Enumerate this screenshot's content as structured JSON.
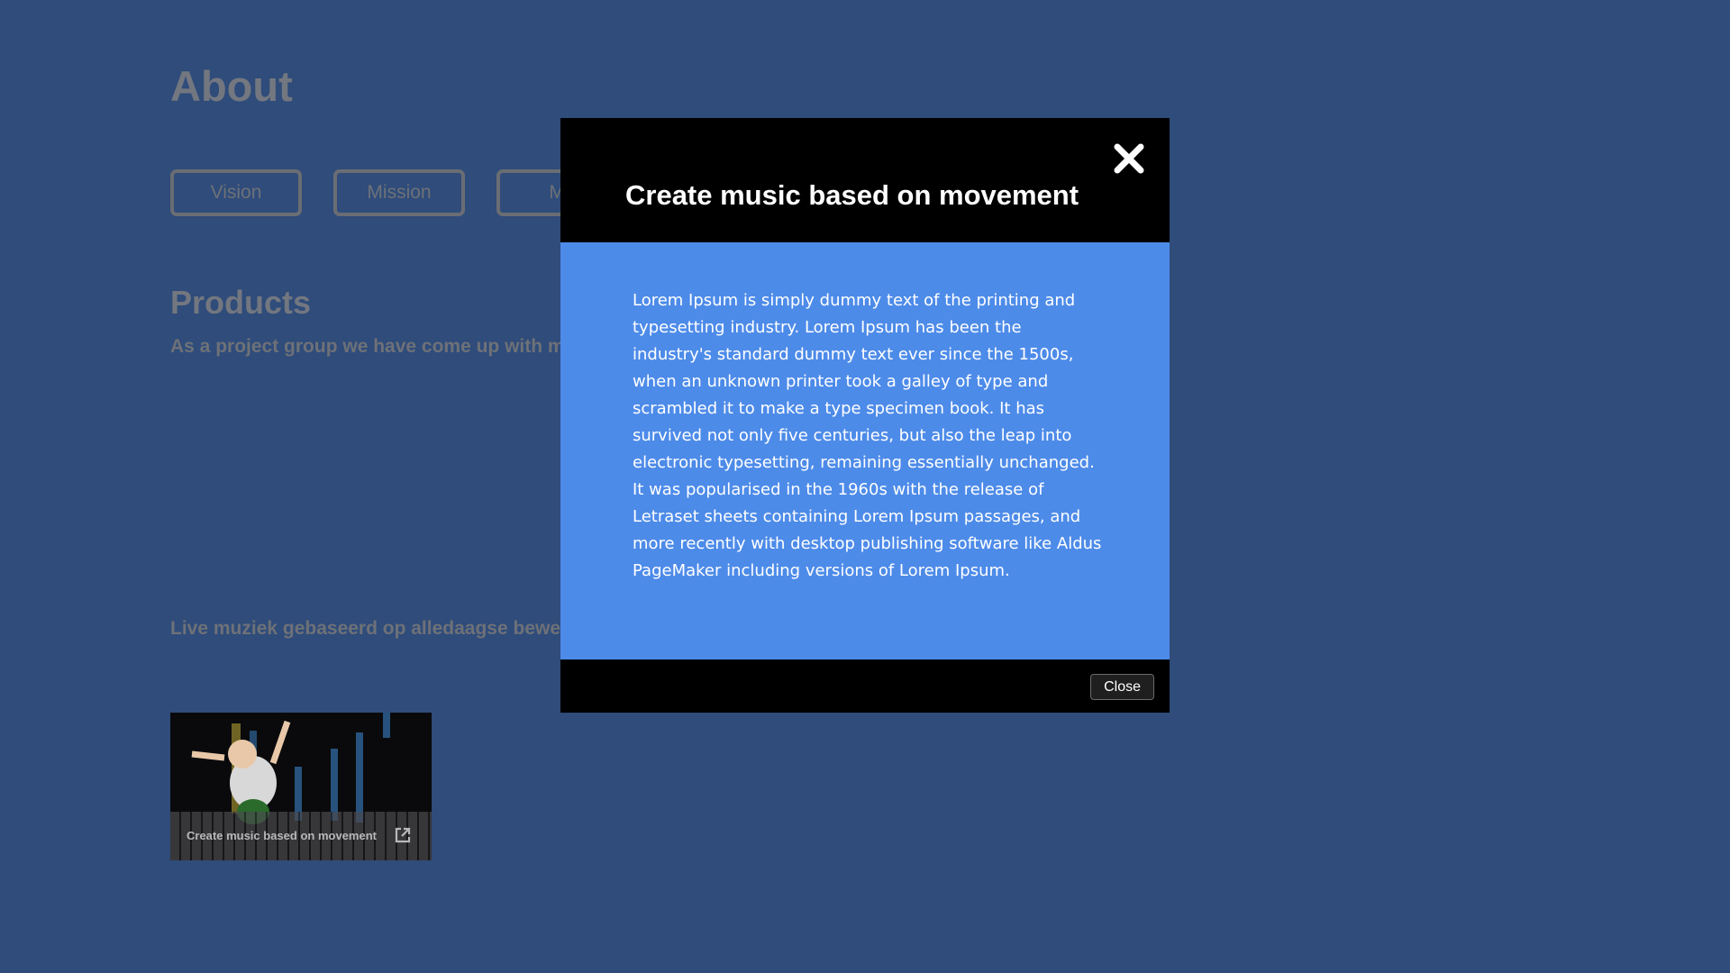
{
  "about": {
    "title": "About",
    "tabs": [
      "Vision",
      "Mission",
      "Mo"
    ]
  },
  "products": {
    "title": "Products",
    "description": "As a project group we have come up with ma",
    "live_text": "Live muziek gebaseerd op alledaagse bewegi",
    "card": {
      "caption": "Create music based on movement",
      "icon": "external-link-icon"
    }
  },
  "modal": {
    "title": "Create music based on movement",
    "close_icon": "close-x-icon",
    "body": "Lorem Ipsum is simply dummy text of the printing and typesetting industry. Lorem Ipsum has been the industry's standard dummy text ever since the 1500s, when an unknown printer took a galley of type and scrambled it to make a type specimen book. It has survived not only five centuries, but also the leap into electronic typesetting, remaining essentially unchanged. It was popularised in the 1960s with the release of Letraset sheets containing Lorem Ipsum passages, and more recently with desktop publishing software like Aldus PageMaker including versions of Lorem Ipsum.",
    "close_label": "Close"
  },
  "colors": {
    "background": "#2f4c7a",
    "modal_body": "#4d8be9",
    "modal_frame": "#000000"
  }
}
